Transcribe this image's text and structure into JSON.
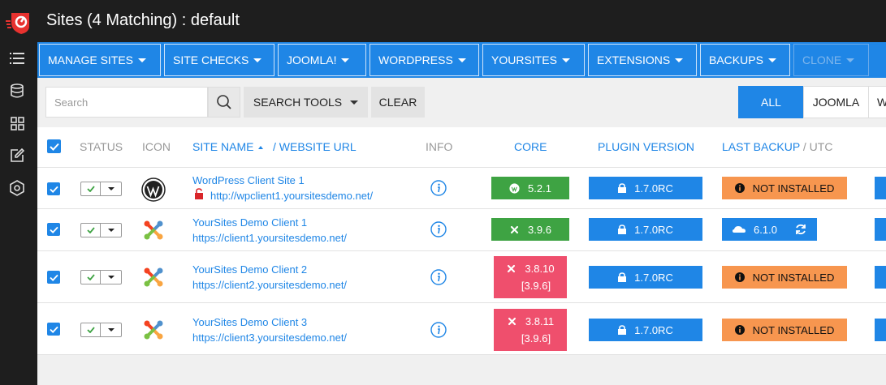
{
  "header": {
    "title": "Sites (4 Matching) : default"
  },
  "nav": {
    "items": [
      {
        "label": "MANAGE SITES"
      },
      {
        "label": "SITE CHECKS"
      },
      {
        "label": "JOOMLA!"
      },
      {
        "label": "WORDPRESS"
      },
      {
        "label": "YOURSITES"
      },
      {
        "label": "EXTENSIONS"
      },
      {
        "label": "BACKUPS"
      },
      {
        "label": "CLONE"
      }
    ]
  },
  "toolbar": {
    "search_placeholder": "Search",
    "search_tools_label": "SEARCH TOOLS",
    "clear_label": "CLEAR",
    "filters": [
      {
        "label": "ALL",
        "active": true
      },
      {
        "label": "JOOMLA"
      },
      {
        "label": "W"
      }
    ]
  },
  "table": {
    "headers": {
      "status": "STATUS",
      "icon": "ICON",
      "site_name": "SITE NAME",
      "website_url": "/ WEBSITE URL",
      "info": "INFO",
      "core": "CORE",
      "plugin_version": "PLUGIN VERSION",
      "last_backup": "LAST BACKUP",
      "utc": "/ UTC"
    },
    "rows": [
      {
        "name": "WordPress Client Site 1",
        "url": "http://wpclient1.yoursitesdemo.net/",
        "cms": "wordpress",
        "core": "5.2.1",
        "plugin": "1.7.0RC",
        "backup": "NOT INSTALLED"
      },
      {
        "name": "YourSites Demo Client 1",
        "url": "https://client1.yoursitesdemo.net/",
        "cms": "joomla",
        "core": "3.9.6",
        "plugin": "1.7.0RC",
        "backup": "6.1.0"
      },
      {
        "name": "YourSites Demo Client 2",
        "url": "https://client2.yoursitesdemo.net/",
        "cms": "joomla",
        "core": "3.8.10",
        "core_latest": "[3.9.6]",
        "plugin": "1.7.0RC",
        "backup": "NOT INSTALLED"
      },
      {
        "name": "YourSites Demo Client 3",
        "url": "https://client3.yoursitesdemo.net/",
        "cms": "joomla",
        "core": "3.8.11",
        "core_latest": "[3.9.6]",
        "plugin": "1.7.0RC",
        "backup": "NOT INSTALLED"
      }
    ]
  },
  "colors": {
    "accent": "#1f86e6",
    "success": "#3ea343",
    "danger": "#ef4f6d",
    "warning": "#f7964f",
    "dark": "#1e1e1e"
  }
}
